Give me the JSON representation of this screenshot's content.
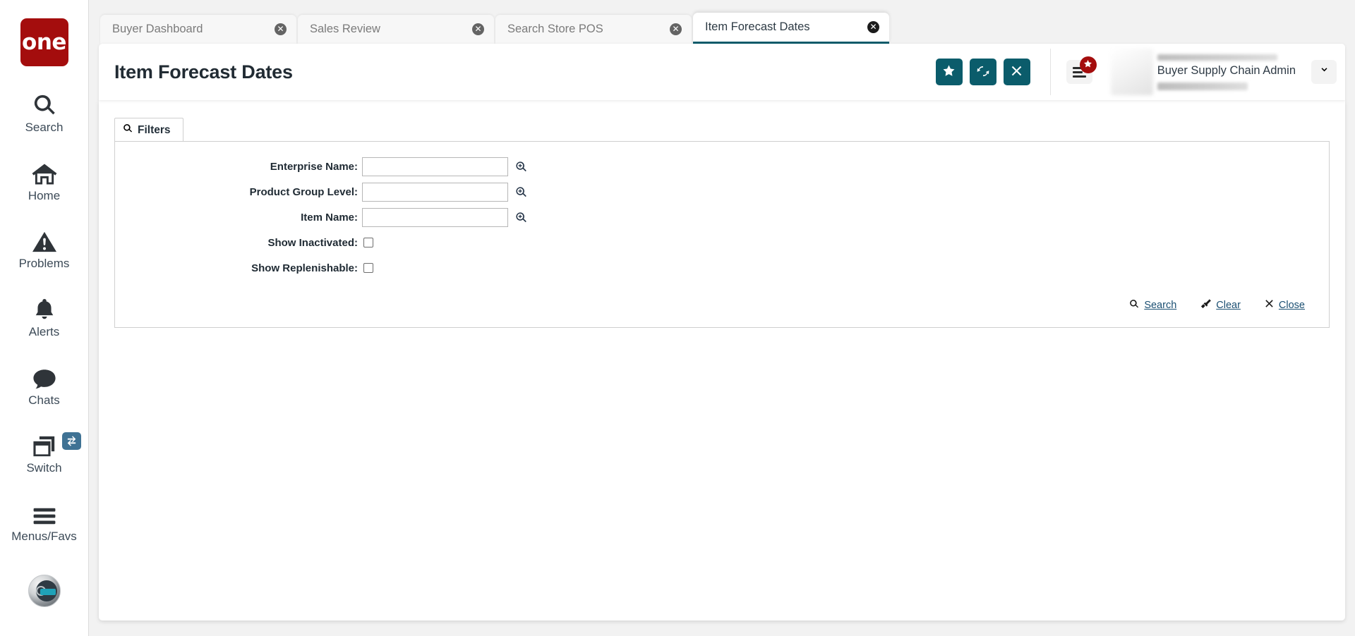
{
  "brand": {
    "logo_text": "one",
    "logo_color": "#a40d0d",
    "accent_color": "#0b5c6b"
  },
  "sidebar": {
    "items": [
      {
        "label": "Search",
        "icon": "search-icon"
      },
      {
        "label": "Home",
        "icon": "home-icon"
      },
      {
        "label": "Problems",
        "icon": "warning-triangle-icon"
      },
      {
        "label": "Alerts",
        "icon": "bell-icon"
      },
      {
        "label": "Chats",
        "icon": "chat-bubble-icon"
      },
      {
        "label": "Switch",
        "icon": "switch-windows-icon",
        "badge_icon": "swap-arrows-icon"
      },
      {
        "label": "Menus/Favs",
        "icon": "hamburger-icon"
      }
    ],
    "assistant_icon": "robot-assistant-avatar"
  },
  "tabs": [
    {
      "label": "Buyer Dashboard",
      "active": false,
      "close_icon": "close-circle-icon"
    },
    {
      "label": "Sales Review",
      "active": false,
      "close_icon": "close-circle-icon"
    },
    {
      "label": "Search Store POS",
      "active": false,
      "close_icon": "close-circle-icon"
    },
    {
      "label": "Item Forecast Dates",
      "active": true,
      "close_icon": "close-circle-icon"
    }
  ],
  "header": {
    "title": "Item Forecast Dates",
    "actions": [
      {
        "name": "favorite-button",
        "icon": "star-icon"
      },
      {
        "name": "refresh-button",
        "icon": "refresh-icon"
      },
      {
        "name": "close-button",
        "icon": "x-icon"
      }
    ],
    "menu_button": {
      "icon": "hamburger-icon",
      "badge_icon": "star-icon"
    },
    "user": {
      "role": "Buyer Supply Chain Admin",
      "caret_icon": "chevron-down-icon"
    }
  },
  "filters": {
    "panel_title": "Filters",
    "panel_icon": "search-icon",
    "fields": [
      {
        "label": "Enterprise Name:",
        "value": "",
        "placeholder": "",
        "type": "text",
        "picker_icon": "magnifier-plus-icon"
      },
      {
        "label": "Product Group Level:",
        "value": "",
        "placeholder": "",
        "type": "text",
        "picker_icon": "magnifier-plus-icon"
      },
      {
        "label": "Item Name:",
        "value": "",
        "placeholder": "",
        "type": "text",
        "picker_icon": "magnifier-plus-icon"
      }
    ],
    "checkboxes": [
      {
        "label": "Show Inactivated:",
        "checked": false
      },
      {
        "label": "Show Replenishable:",
        "checked": false
      }
    ],
    "actions": [
      {
        "label": "Search",
        "icon": "search-icon"
      },
      {
        "label": "Clear",
        "icon": "broom-icon"
      },
      {
        "label": "Close",
        "icon": "x-icon"
      }
    ]
  }
}
